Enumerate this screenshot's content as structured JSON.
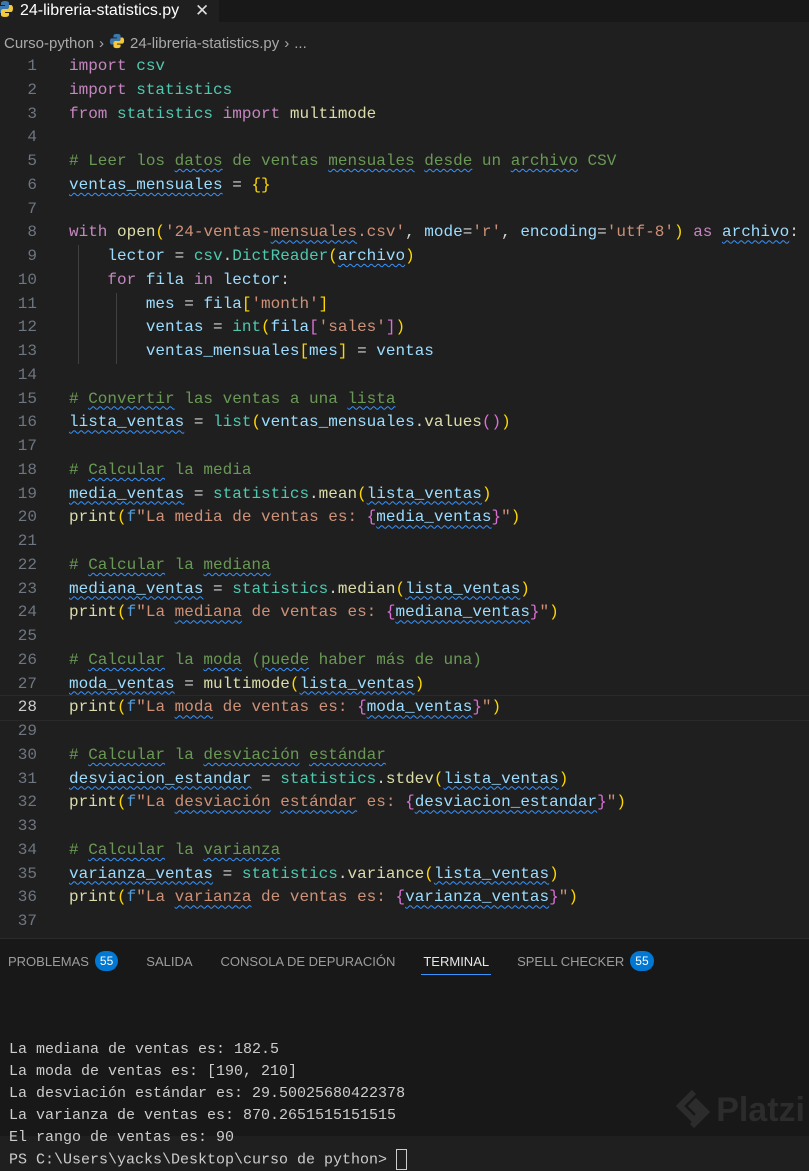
{
  "tab": {
    "title": "24-libreria-statistics.py",
    "close": "✕"
  },
  "breadcrumb": {
    "folder": "Curso-python",
    "file": "24-libreria-statistics.py",
    "more": "..."
  },
  "code": [
    [
      [
        "k",
        "import"
      ],
      [
        "p",
        " "
      ],
      [
        "m",
        "csv"
      ]
    ],
    [
      [
        "k",
        "import"
      ],
      [
        "p",
        " "
      ],
      [
        "m",
        "statistics"
      ]
    ],
    [
      [
        "k",
        "from"
      ],
      [
        "p",
        " "
      ],
      [
        "m",
        "statistics"
      ],
      [
        "p",
        " "
      ],
      [
        "k",
        "import"
      ],
      [
        "p",
        " "
      ],
      [
        "f",
        "multimode"
      ]
    ],
    [],
    [
      [
        "c",
        "# Leer los "
      ],
      [
        "c",
        "datos",
        "sq"
      ],
      [
        "c",
        " de ventas "
      ],
      [
        "c",
        "mensuales",
        "sq"
      ],
      [
        "c",
        " "
      ],
      [
        "c",
        "desde",
        "sq"
      ],
      [
        "c",
        " un "
      ],
      [
        "c",
        "archivo",
        "sq"
      ],
      [
        "c",
        " CSV"
      ]
    ],
    [
      [
        "v",
        "ventas_mensuales",
        "sq"
      ],
      [
        "p",
        " = "
      ],
      [
        "b1",
        "{}"
      ]
    ],
    [],
    [
      [
        "k",
        "with"
      ],
      [
        "p",
        " "
      ],
      [
        "f",
        "open"
      ],
      [
        "b1",
        "("
      ],
      [
        "s",
        "'24-ventas-"
      ],
      [
        "s",
        "mensuales",
        "sq"
      ],
      [
        "s",
        ".csv'"
      ],
      [
        "p",
        ", "
      ],
      [
        "v",
        "mode"
      ],
      [
        "p",
        "="
      ],
      [
        "s",
        "'r'"
      ],
      [
        "p",
        ", "
      ],
      [
        "v",
        "encoding"
      ],
      [
        "p",
        "="
      ],
      [
        "s",
        "'utf-8'"
      ],
      [
        "b1",
        ")"
      ],
      [
        "p",
        " "
      ],
      [
        "k",
        "as"
      ],
      [
        "p",
        " "
      ],
      [
        "v",
        "archivo",
        "sq"
      ],
      [
        "p",
        ":"
      ]
    ],
    [
      [
        "p",
        "    "
      ],
      [
        "v",
        "lector"
      ],
      [
        "p",
        " = "
      ],
      [
        "m",
        "csv"
      ],
      [
        "p",
        "."
      ],
      [
        "m",
        "DictReader"
      ],
      [
        "b1",
        "("
      ],
      [
        "v",
        "archivo",
        "sq"
      ],
      [
        "b1",
        ")"
      ]
    ],
    [
      [
        "p",
        "    "
      ],
      [
        "k",
        "for"
      ],
      [
        "p",
        " "
      ],
      [
        "v",
        "fila"
      ],
      [
        "p",
        " "
      ],
      [
        "k",
        "in"
      ],
      [
        "p",
        " "
      ],
      [
        "v",
        "lector"
      ],
      [
        "p",
        ":"
      ]
    ],
    [
      [
        "p",
        "        "
      ],
      [
        "v",
        "mes"
      ],
      [
        "p",
        " = "
      ],
      [
        "v",
        "fila"
      ],
      [
        "b1",
        "["
      ],
      [
        "s",
        "'month'"
      ],
      [
        "b1",
        "]"
      ]
    ],
    [
      [
        "p",
        "        "
      ],
      [
        "v",
        "ventas"
      ],
      [
        "p",
        " = "
      ],
      [
        "m",
        "int"
      ],
      [
        "b1",
        "("
      ],
      [
        "v",
        "fila"
      ],
      [
        "b2",
        "["
      ],
      [
        "s",
        "'sales'"
      ],
      [
        "b2",
        "]"
      ],
      [
        "b1",
        ")"
      ]
    ],
    [
      [
        "p",
        "        "
      ],
      [
        "v",
        "ventas_mensuales"
      ],
      [
        "b1",
        "["
      ],
      [
        "v",
        "mes"
      ],
      [
        "b1",
        "]"
      ],
      [
        "p",
        " = "
      ],
      [
        "v",
        "ventas"
      ]
    ],
    [],
    [
      [
        "c",
        "# "
      ],
      [
        "c",
        "Convertir",
        "sq"
      ],
      [
        "c",
        " las ventas a una "
      ],
      [
        "c",
        "lista",
        "sq"
      ]
    ],
    [
      [
        "v",
        "lista_ventas",
        "sq"
      ],
      [
        "p",
        " = "
      ],
      [
        "m",
        "list"
      ],
      [
        "b1",
        "("
      ],
      [
        "v",
        "ventas_mensuales"
      ],
      [
        "p",
        "."
      ],
      [
        "f",
        "values"
      ],
      [
        "b2",
        "()"
      ],
      [
        "b1",
        ")"
      ]
    ],
    [],
    [
      [
        "c",
        "# "
      ],
      [
        "c",
        "Calcular",
        "sq"
      ],
      [
        "c",
        " la media"
      ]
    ],
    [
      [
        "v",
        "media_ventas",
        "sq"
      ],
      [
        "p",
        " = "
      ],
      [
        "m",
        "statistics"
      ],
      [
        "p",
        "."
      ],
      [
        "f",
        "mean"
      ],
      [
        "b1",
        "("
      ],
      [
        "v",
        "lista_ventas",
        "sq"
      ],
      [
        "b1",
        ")"
      ]
    ],
    [
      [
        "f",
        "print"
      ],
      [
        "b1",
        "("
      ],
      [
        "e",
        "f"
      ],
      [
        "s",
        "\"La media de ventas es: "
      ],
      [
        "b2",
        "{"
      ],
      [
        "v",
        "media_ventas",
        "sq"
      ],
      [
        "b2",
        "}"
      ],
      [
        "s",
        "\""
      ],
      [
        "b1",
        ")"
      ]
    ],
    [],
    [
      [
        "c",
        "# "
      ],
      [
        "c",
        "Calcular",
        "sq"
      ],
      [
        "c",
        " la "
      ],
      [
        "c",
        "mediana",
        "sq"
      ]
    ],
    [
      [
        "v",
        "mediana_ventas",
        "sq"
      ],
      [
        "p",
        " = "
      ],
      [
        "m",
        "statistics"
      ],
      [
        "p",
        "."
      ],
      [
        "f",
        "median"
      ],
      [
        "b1",
        "("
      ],
      [
        "v",
        "lista_ventas",
        "sq"
      ],
      [
        "b1",
        ")"
      ]
    ],
    [
      [
        "f",
        "print"
      ],
      [
        "b1",
        "("
      ],
      [
        "e",
        "f"
      ],
      [
        "s",
        "\"La "
      ],
      [
        "s",
        "mediana",
        "sq"
      ],
      [
        "s",
        " de ventas es: "
      ],
      [
        "b2",
        "{"
      ],
      [
        "v",
        "mediana_ventas",
        "sq"
      ],
      [
        "b2",
        "}"
      ],
      [
        "s",
        "\""
      ],
      [
        "b1",
        ")"
      ]
    ],
    [],
    [
      [
        "c",
        "# "
      ],
      [
        "c",
        "Calcular",
        "sq"
      ],
      [
        "c",
        " la "
      ],
      [
        "c",
        "moda",
        "sq"
      ],
      [
        "c",
        " ("
      ],
      [
        "c",
        "puede",
        "sq"
      ],
      [
        "c",
        " haber más de una)"
      ]
    ],
    [
      [
        "v",
        "moda_ventas",
        "sq"
      ],
      [
        "p",
        " = "
      ],
      [
        "f",
        "multimode"
      ],
      [
        "b1",
        "("
      ],
      [
        "v",
        "lista_ventas",
        "sq"
      ],
      [
        "b1",
        ")"
      ]
    ],
    [
      [
        "f",
        "print"
      ],
      [
        "b1",
        "("
      ],
      [
        "e",
        "f"
      ],
      [
        "s",
        "\"La "
      ],
      [
        "s",
        "moda",
        "sq"
      ],
      [
        "s",
        " de ventas es: "
      ],
      [
        "b2",
        "{"
      ],
      [
        "v",
        "moda_ventas",
        "sq"
      ],
      [
        "b2",
        "}"
      ],
      [
        "s",
        "\""
      ],
      [
        "b1",
        ")"
      ]
    ],
    [],
    [
      [
        "c",
        "# "
      ],
      [
        "c",
        "Calcular",
        "sq"
      ],
      [
        "c",
        " la "
      ],
      [
        "c",
        "desviación",
        "sq"
      ],
      [
        "c",
        " "
      ],
      [
        "c",
        "estándar",
        "sq"
      ]
    ],
    [
      [
        "v",
        "desviacion_estandar",
        "sq"
      ],
      [
        "p",
        " = "
      ],
      [
        "m",
        "statistics"
      ],
      [
        "p",
        "."
      ],
      [
        "f",
        "stdev"
      ],
      [
        "b1",
        "("
      ],
      [
        "v",
        "lista_ventas",
        "sq"
      ],
      [
        "b1",
        ")"
      ]
    ],
    [
      [
        "f",
        "print"
      ],
      [
        "b1",
        "("
      ],
      [
        "e",
        "f"
      ],
      [
        "s",
        "\"La "
      ],
      [
        "s",
        "desviación",
        "sq"
      ],
      [
        "s",
        " "
      ],
      [
        "s",
        "estándar",
        "sq"
      ],
      [
        "s",
        " es: "
      ],
      [
        "b2",
        "{"
      ],
      [
        "v",
        "desviacion_estandar",
        "sq"
      ],
      [
        "b2",
        "}"
      ],
      [
        "s",
        "\""
      ],
      [
        "b1",
        ")"
      ]
    ],
    [],
    [
      [
        "c",
        "# "
      ],
      [
        "c",
        "Calcular",
        "sq"
      ],
      [
        "c",
        " la "
      ],
      [
        "c",
        "varianza",
        "sq"
      ]
    ],
    [
      [
        "v",
        "varianza_ventas",
        "sq"
      ],
      [
        "p",
        " = "
      ],
      [
        "m",
        "statistics"
      ],
      [
        "p",
        "."
      ],
      [
        "f",
        "variance"
      ],
      [
        "b1",
        "("
      ],
      [
        "v",
        "lista_ventas",
        "sq"
      ],
      [
        "b1",
        ")"
      ]
    ],
    [
      [
        "f",
        "print"
      ],
      [
        "b1",
        "("
      ],
      [
        "e",
        "f"
      ],
      [
        "s",
        "\"La "
      ],
      [
        "s",
        "varianza",
        "sq"
      ],
      [
        "s",
        " de ventas es: "
      ],
      [
        "b2",
        "{"
      ],
      [
        "v",
        "varianza_ventas",
        "sq"
      ],
      [
        "b2",
        "}"
      ],
      [
        "s",
        "\""
      ],
      [
        "b1",
        ")"
      ]
    ],
    []
  ],
  "current_line": 28,
  "panel": {
    "tabs": [
      {
        "label": "PROBLEMAS",
        "badge": "55"
      },
      {
        "label": "SALIDA"
      },
      {
        "label": "CONSOLA DE DEPURACIÓN"
      },
      {
        "label": "TERMINAL",
        "active": true
      },
      {
        "label": "SPELL CHECKER",
        "badge": "55"
      }
    ],
    "terminal": [
      "La mediana de ventas es: 182.5",
      "La moda de ventas es: [190, 210]",
      "La desviación estándar es: 29.50025680422378",
      "La varianza de ventas es: 870.2651515151515",
      "El rango de ventas es: 90"
    ],
    "prompt": "PS C:\\Users\\yacks\\Desktop\\curso de python> "
  },
  "watermark": "Platzi"
}
